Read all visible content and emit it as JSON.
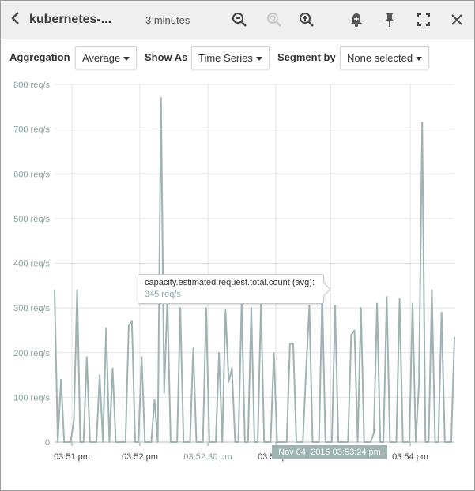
{
  "header": {
    "back_icon": "chevron-left-icon",
    "title": "kubernetes-...",
    "time_range": "3 minutes",
    "icons": [
      "zoom-out-icon",
      "undo-zoom-icon",
      "zoom-in-icon",
      "alert-bell-icon",
      "pin-icon",
      "expand-icon",
      "close-icon"
    ]
  },
  "toolbar": {
    "aggregation_label": "Aggregation",
    "aggregation_value": "Average",
    "show_as_label": "Show As",
    "show_as_value": "Time Series",
    "segment_label": "Segment by",
    "segment_value": "None selected"
  },
  "tooltip": {
    "metric": "capacity.estimated.request.total.count (avg):",
    "value": "345 req/s"
  },
  "crosshair_label": "Nov 04, 2015 03:53:24 pm",
  "colors": {
    "line": "#9fb3b3",
    "grid": "#e3e3e3",
    "axis_text": "#8aa0a0",
    "header_bg": "#efefef"
  },
  "chart_data": {
    "type": "line",
    "ylim": [
      0,
      800
    ],
    "y_ticks": [
      "800 req/s",
      "700 req/s",
      "600 req/s",
      "500 req/s",
      "400 req/s",
      "300 req/s",
      "200 req/s",
      "100 req/s",
      "0"
    ],
    "x_ticks": [
      "03:51 pm",
      "03:52 pm",
      "03:52:30 pm",
      "03:53 pm",
      "03:54 pm"
    ],
    "series": [
      {
        "values": [
          340,
          0,
          140,
          0,
          0,
          0,
          50,
          340,
          0,
          0,
          190,
          0,
          0,
          0,
          150,
          0,
          255,
          0,
          165,
          0,
          0,
          0,
          0,
          260,
          270,
          0,
          0,
          190,
          0,
          0,
          0,
          95,
          0,
          770,
          110,
          320,
          0,
          0,
          0,
          300,
          0,
          0,
          0,
          210,
          0,
          0,
          0,
          300,
          0,
          0,
          0,
          200,
          0,
          295,
          135,
          165,
          0,
          0,
          310,
          0,
          0,
          300,
          0,
          0,
          310,
          0,
          0,
          0,
          200,
          0,
          0,
          0,
          0,
          220,
          220,
          0,
          0,
          0,
          160,
          305,
          0,
          0,
          0,
          330,
          0,
          0,
          0,
          305,
          0,
          0,
          0,
          0,
          240,
          250,
          0,
          300,
          0,
          0,
          0,
          20,
          310,
          0,
          0,
          325,
          0,
          0,
          0,
          320,
          0,
          0,
          0,
          310,
          0,
          130,
          715,
          0,
          0,
          340,
          0,
          0,
          290,
          0,
          0,
          0,
          235
        ]
      }
    ]
  }
}
